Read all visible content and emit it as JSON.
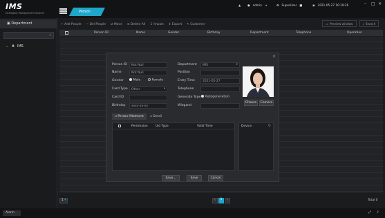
{
  "app": {
    "logo": "IMS",
    "subtitle": "Intelligent Management System",
    "tab": "Person",
    "user": "admin",
    "role": "SuperUser",
    "datetime": "2021-05-27 10:19:36"
  },
  "sidebar": {
    "title": "Department",
    "search_placeholder": "",
    "tree_root": "IMS"
  },
  "toolbar": {
    "items": [
      "Add People",
      "Del People",
      "Move",
      "Delete All",
      "Import",
      "Export",
      "Customer"
    ],
    "preview_label": "Preview window",
    "search_label": "Search"
  },
  "table": {
    "columns": [
      "Person ID",
      "Name",
      "Gender",
      "Birthday",
      "Department",
      "Telephone",
      "Operation"
    ]
  },
  "pager": {
    "page_size": "1",
    "current": "1",
    "total": "Total 0"
  },
  "status": {
    "alarm": "Alarm"
  },
  "dialog": {
    "fields": {
      "person_id_label": "Person ID",
      "person_id_value": "Not Null",
      "name_label": "Name",
      "name_value": "Not Null",
      "gender_label": "Gender",
      "male": "Male",
      "female": "Female",
      "card_type_label": "Card Type",
      "card_type_value": "Other",
      "card_id_label": "Card ID",
      "card_id_value": "",
      "birthday_label": "Birthday",
      "birthday_value": "xxxx-xx-xx",
      "department_label": "Department",
      "department_value": "IMS",
      "position_label": "Position",
      "position_value": "",
      "entry_time_label": "Entry Time",
      "entry_time_value": "2021-05-27",
      "telephone_label": "Telephone",
      "telephone_value": "",
      "generate_type_label": "Generate Type",
      "generate_type_value": "Autogeneration",
      "wiegand_label": "Wiegand",
      "wiegand_value": ""
    },
    "photo_buttons": {
      "choose": "Choose",
      "camera": "Camera"
    },
    "tabs": {
      "allotment": "Person Allotment",
      "detail": "Detail"
    },
    "perm_columns": [
      "Permission",
      "Uid Type",
      "Valid Time"
    ],
    "device_label": "Device",
    "buttons": {
      "save_new": "Save...",
      "save": "Save",
      "cancel": "Cancel"
    },
    "close": "×"
  },
  "colors": {
    "accent": "#1fa7c9",
    "bg": "#1b1c1e",
    "panel": "#2a2b2f"
  }
}
